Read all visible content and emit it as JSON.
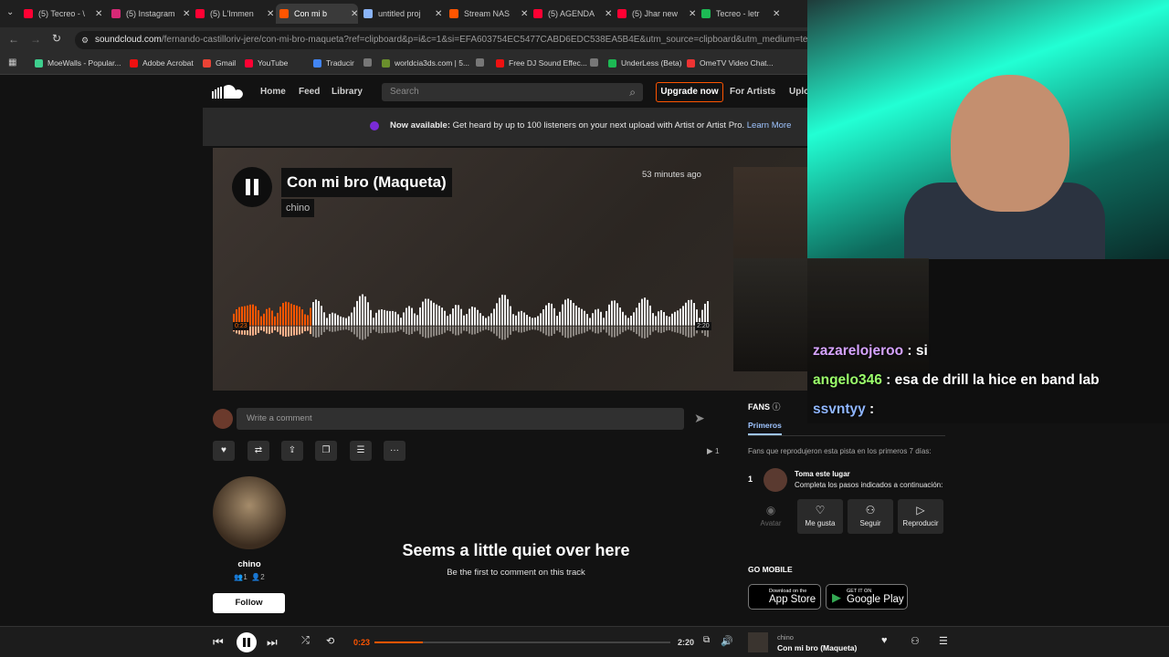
{
  "browser": {
    "tabs": [
      {
        "title": "(5) Tecreo - \\",
        "color": "#ff0033"
      },
      {
        "title": "(5) Instagram",
        "color": "#d62976"
      },
      {
        "title": "(5) L'Immen",
        "color": "#ff0033"
      },
      {
        "title": "Con mi b",
        "color": "#ff5500"
      },
      {
        "title": "untitled proj",
        "color": "#8ab4f8"
      },
      {
        "title": "Stream NAS",
        "color": "#ff5500"
      },
      {
        "title": "(5) AGENDA",
        "color": "#ff0033"
      },
      {
        "title": "(5) Jhar new",
        "color": "#ff0033"
      },
      {
        "title": "Tecreo - letr",
        "color": "#1db954"
      }
    ],
    "url_host": "soundcloud.com",
    "url_path": "/fernando-castilloriv-jere/con-mi-bro-maqueta?ref=clipboard&p=i&c=1&si=EFA603754EC5477CABD6EDC538EA5B4E&utm_source=clipboard&utm_medium=text&utm_can",
    "bookmarks": [
      {
        "label": "MoeWalls - Popular...",
        "color": "#3ecf8e"
      },
      {
        "label": "Adobe Acrobat",
        "color": "#e11"
      },
      {
        "label": "Gmail",
        "color": "#ea4335"
      },
      {
        "label": "YouTube",
        "color": "#ff0033"
      },
      {
        "label": "Traducir",
        "color": "#4285f4"
      },
      {
        "label": "",
        "color": "#777"
      },
      {
        "label": "worldcia3ds.com | 5...",
        "color": "#6a8f2c"
      },
      {
        "label": "",
        "color": "#777"
      },
      {
        "label": "Free DJ Sound Effec...",
        "color": "#e11"
      },
      {
        "label": "",
        "color": "#777"
      },
      {
        "label": "UnderLess (Beta)",
        "color": "#1db954"
      },
      {
        "label": "OmeTV Video Chat...",
        "color": "#e33"
      }
    ]
  },
  "nav": {
    "home": "Home",
    "feed": "Feed",
    "library": "Library",
    "search_placeholder": "Search",
    "upgrade": "Upgrade now",
    "for_artists": "For Artists",
    "upload": "Uplo"
  },
  "banner": {
    "bold": "Now available:",
    "text": " Get heard by up to 100 listeners on your next upload with Artist or Artist Pro.",
    "link": "Learn More"
  },
  "track": {
    "title": "Con mi bro (Maqueta)",
    "artist": "chino",
    "posted": "53 minutes ago",
    "current_time": "0:23",
    "duration": "2:20",
    "progress": 0.164
  },
  "comment_placeholder": "Write a comment",
  "plays": "1",
  "user": {
    "name": "chino",
    "followers": "1",
    "following": "2",
    "follow_label": "Follow"
  },
  "empty": {
    "title": "Seems a little quiet over here",
    "subtitle": "Be the first to comment on this track"
  },
  "fans": {
    "label": "FANS",
    "tab": "Primeros",
    "desc": "Fans que reprodujeron esta pista en los primeros 7 días:",
    "rank": "1",
    "rank_title": "Toma este lugar",
    "rank_sub": "Completa los pasos indicados a continuación:",
    "steps": [
      "Avatar",
      "Me gusta",
      "Seguir",
      "Reproducir"
    ]
  },
  "mobile": {
    "label": "GO MOBILE",
    "appstore_small": "Download on the",
    "appstore": "App Store",
    "play_small": "GET IT ON",
    "play": "Google Play"
  },
  "chat": [
    {
      "user": "zazarelojeroo",
      "color": "#d6a3ff",
      "msg": " : si"
    },
    {
      "user": "angelo346",
      "color": "#9bff6b",
      "msg": " : esa de drill la hice en band lab"
    },
    {
      "user": "ssvntyy",
      "color": "#8fb6ff",
      "msg": " :"
    }
  ],
  "player": {
    "artist": "chino",
    "title": "Con mi bro (Maqueta)",
    "current": "0:23",
    "duration": "2:20"
  }
}
